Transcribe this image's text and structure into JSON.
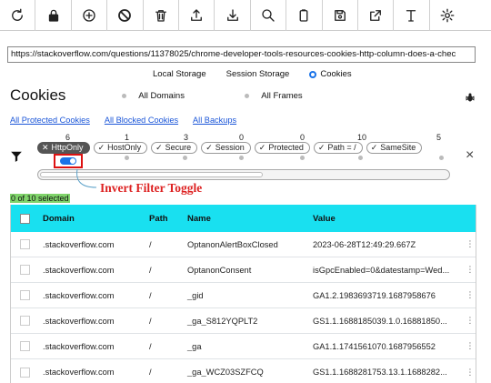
{
  "toolbar": {
    "buttons": [
      {
        "icon": "refresh-icon"
      },
      {
        "icon": "lock-icon"
      },
      {
        "icon": "add-circle-icon"
      },
      {
        "icon": "block-icon"
      },
      {
        "icon": "trash-icon"
      },
      {
        "icon": "import-icon"
      },
      {
        "icon": "export-icon"
      },
      {
        "icon": "search-icon"
      },
      {
        "icon": "clipboard-icon"
      },
      {
        "icon": "save-icon"
      },
      {
        "icon": "open-external-icon"
      },
      {
        "icon": "text-icon"
      },
      {
        "icon": "gear-icon"
      }
    ]
  },
  "url": "https://stackoverflow.com/questions/11378025/chrome-developer-tools-resources-cookies-http-column-does-a-chec",
  "storage": {
    "local": "Local Storage",
    "session": "Session Storage",
    "cookies": "Cookies",
    "selected": "cookies"
  },
  "title": "Cookies",
  "scope": {
    "all_domains": "All Domains",
    "all_frames": "All Frames"
  },
  "links": {
    "protected": "All Protected Cookies",
    "blocked": "All Blocked Cookies",
    "backups": "All Backups"
  },
  "filters": [
    {
      "label": "HttpOnly",
      "count": "6",
      "state": "excluded"
    },
    {
      "label": "HostOnly",
      "count": "1",
      "state": "included"
    },
    {
      "label": "Secure",
      "count": "3",
      "state": "included"
    },
    {
      "label": "Session",
      "count": "0",
      "state": "included"
    },
    {
      "label": "Protected",
      "count": "0",
      "state": "included"
    },
    {
      "label": "Path = /",
      "count": "10",
      "state": "included"
    },
    {
      "label": "SameSite",
      "count": "5",
      "state": "included"
    }
  ],
  "annotation": "Invert Filter Toggle",
  "selection": "0 of 10 selected",
  "colors": {
    "header_bg": "#19e0f0",
    "annotation": "#dd2222",
    "selection_bg": "#7fd36a",
    "link": "#1a55d8"
  },
  "table": {
    "columns": [
      "Domain",
      "Path",
      "Name",
      "Value"
    ],
    "rows": [
      {
        "domain": ".stackoverflow.com",
        "path": "/",
        "name": "OptanonAlertBoxClosed",
        "value": "2023-06-28T12:49:29.667Z"
      },
      {
        "domain": ".stackoverflow.com",
        "path": "/",
        "name": "OptanonConsent",
        "value": "isGpcEnabled=0&datestamp=Wed..."
      },
      {
        "domain": ".stackoverflow.com",
        "path": "/",
        "name": "_gid",
        "value": "GA1.2.1983693719.1687958676"
      },
      {
        "domain": ".stackoverflow.com",
        "path": "/",
        "name": "_ga_S812YQPLT2",
        "value": "GS1.1.1688185039.1.0.16881850..."
      },
      {
        "domain": ".stackoverflow.com",
        "path": "/",
        "name": "_ga",
        "value": "GA1.1.1741561070.1687956552"
      },
      {
        "domain": ".stackoverflow.com",
        "path": "/",
        "name": "_ga_WCZ03SZFCQ",
        "value": "GS1.1.1688281753.13.1.1688282..."
      }
    ]
  }
}
